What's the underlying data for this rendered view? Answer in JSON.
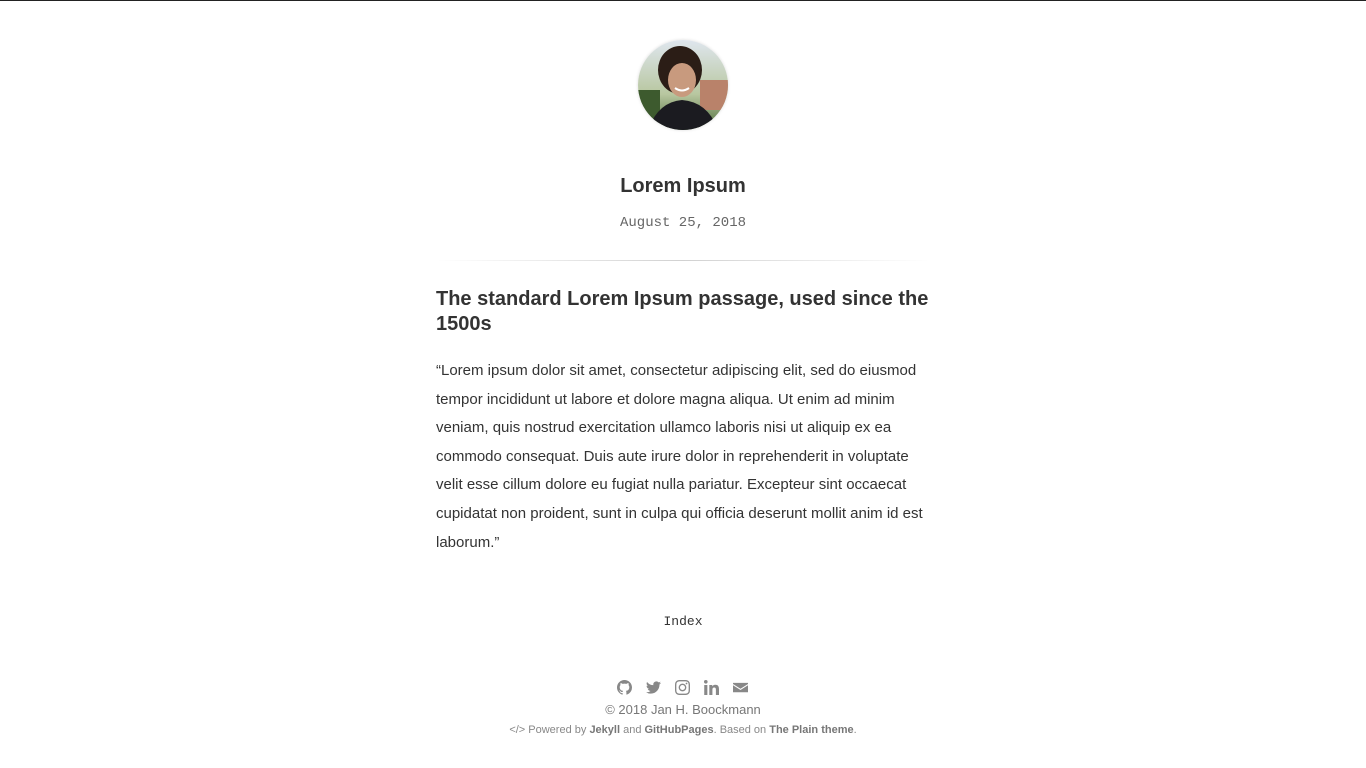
{
  "header": {
    "avatar_alt": "profile photo",
    "title": "Lorem Ipsum",
    "date": "August 25, 2018"
  },
  "post": {
    "heading": "The standard Lorem Ipsum passage, used since the 1500s",
    "body": "“Lorem ipsum dolor sit amet, consectetur adipiscing elit, sed do eiusmod tempor incididunt ut labore et dolore magna aliqua. Ut enim ad minim veniam, quis nostrud exercitation ullamco laboris nisi ut aliquip ex ea commodo consequat. Duis aute irure dolor in reprehenderit in voluptate velit esse cillum dolore eu fugiat nulla pariatur. Excepteur sint occaecat cupidatat non proident, sunt in culpa qui officia deserunt mollit anim id est laborum.”"
  },
  "nav": {
    "index_label": "Index"
  },
  "footer": {
    "social_icons": [
      "github-icon",
      "twitter-icon",
      "instagram-icon",
      "linkedin-icon",
      "envelope-icon"
    ],
    "copyright": "© 2018 Jan H. Boockmann",
    "powered_prefix": "</> Powered by ",
    "jekyll": "Jekyll",
    "and": " and ",
    "githubpages": "GitHubPages",
    "based_on": ". Based on ",
    "theme": "The Plain theme",
    "period": "."
  },
  "colors": {
    "text": "#333333",
    "muted": "#888888",
    "background": "#ffffff"
  }
}
